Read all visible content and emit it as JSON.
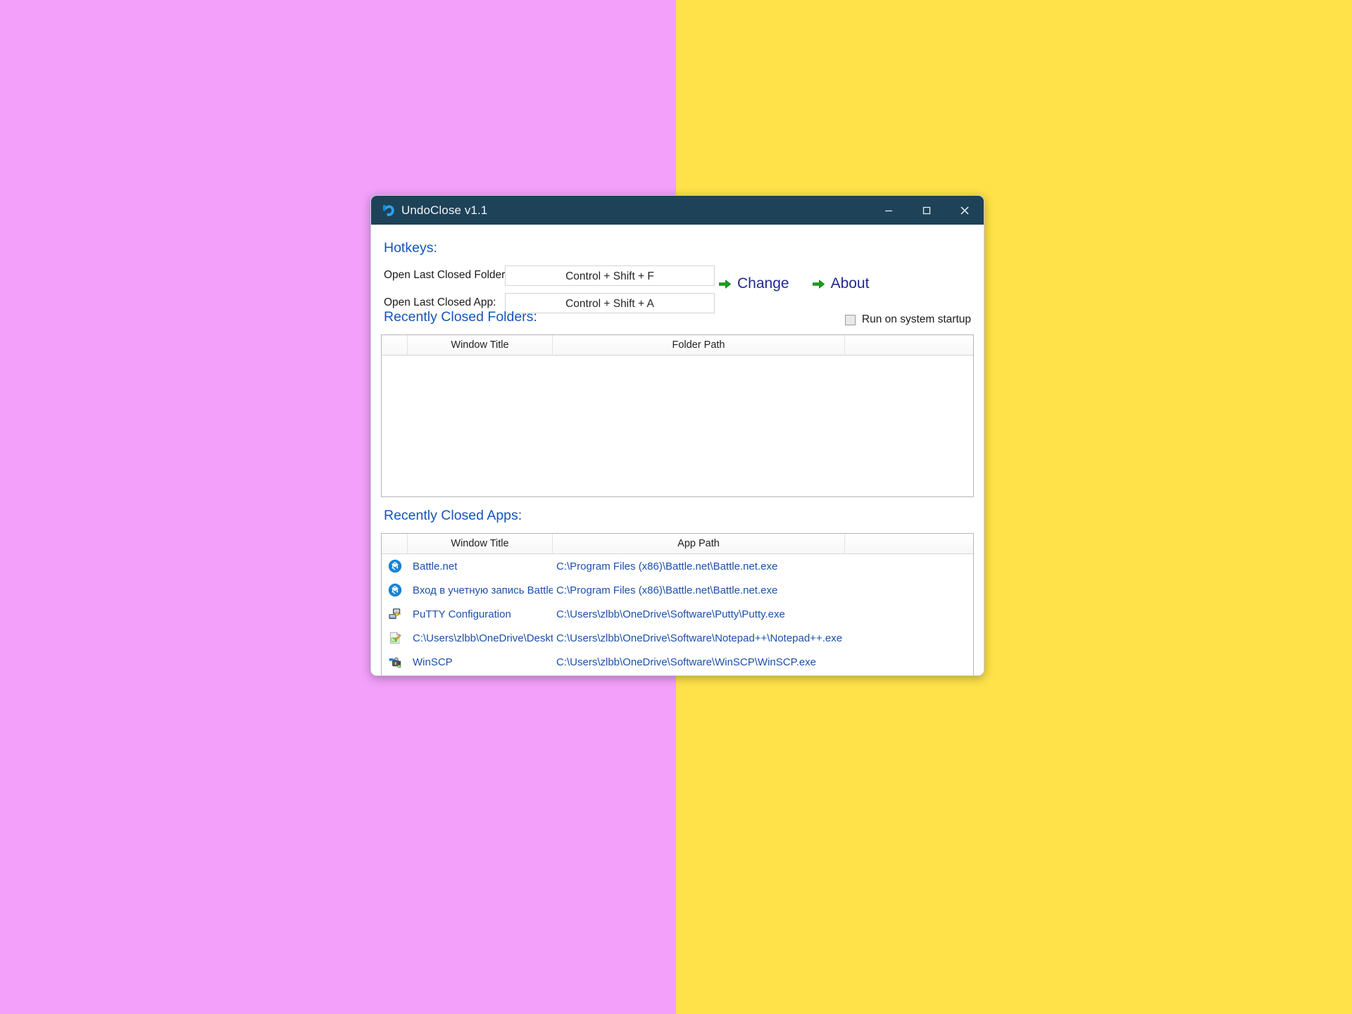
{
  "desktop": {
    "background_left_color": "#f3a0fa",
    "background_right_color": "#ffe249"
  },
  "window": {
    "title": "UndoClose v1.1",
    "icon": "undo-arrow-icon",
    "titlebar_color": "#1e4258",
    "controls": {
      "minimize": "minimize-icon",
      "maximize": "maximize-icon",
      "close": "close-icon"
    }
  },
  "hotkeys": {
    "heading": "Hotkeys:",
    "rows": [
      {
        "label": "Open Last Closed Folder:",
        "value": "Control + Shift + F"
      },
      {
        "label": "Open Last Closed App:",
        "value": "Control + Shift + A"
      }
    ],
    "actions": [
      {
        "label": "Change",
        "icon": "green-arrow-icon"
      },
      {
        "label": "About",
        "icon": "green-arrow-icon"
      }
    ]
  },
  "folders_section": {
    "heading": "Recently Closed Folders:",
    "startup_checkbox": {
      "label": "Run on system startup",
      "checked": false
    },
    "columns": {
      "icon": "",
      "title": "Window Title",
      "path": "Folder Path"
    },
    "rows": []
  },
  "apps_section": {
    "heading": "Recently Closed Apps:",
    "columns": {
      "icon": "",
      "title": "Window Title",
      "path": "App Path"
    },
    "rows": [
      {
        "icon": "battlenet-icon",
        "title": "Battle.net",
        "path": "C:\\Program Files (x86)\\Battle.net\\Battle.net.exe"
      },
      {
        "icon": "battlenet-icon",
        "title": "Вход в учетную запись Battle.",
        "path": "C:\\Program Files (x86)\\Battle.net\\Battle.net.exe"
      },
      {
        "icon": "putty-icon",
        "title": "PuTTY Configuration",
        "path": "C:\\Users\\zlbb\\OneDrive\\Software\\Putty\\Putty.exe"
      },
      {
        "icon": "notepadpp-icon",
        "title": "C:\\Users\\zlbb\\OneDrive\\Desktc",
        "path": "C:\\Users\\zlbb\\OneDrive\\Software\\Notepad++\\Notepad++.exe"
      },
      {
        "icon": "winscp-icon",
        "title": "WinSCP",
        "path": "C:\\Users\\zlbb\\OneDrive\\Software\\WinSCP\\WinSCP.exe"
      }
    ]
  },
  "colors": {
    "link_blue": "#1f4fa8",
    "heading_blue": "#1456b8",
    "action_blue": "#222a8c",
    "arrow_green": "#18a01b"
  }
}
